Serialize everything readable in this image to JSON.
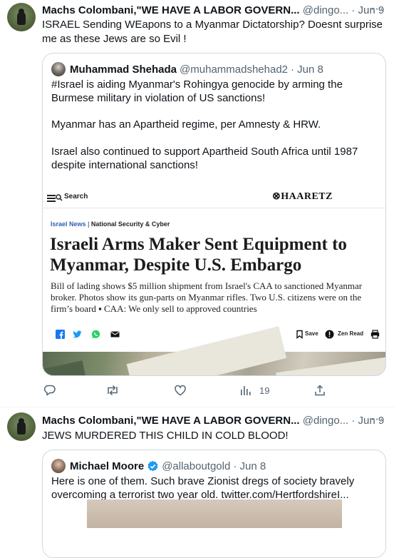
{
  "tweet1": {
    "author_name": "Machs Colombani,\"WE HAVE A LABOR GOVERN...",
    "author_handle": "@dingo...",
    "date": "· Jun 9",
    "more": "···",
    "text": "ISRAEL Sending WEapons to a Myanmar Dictatorship? Doesnt surprise me as these Jews are so Evil !",
    "quote": {
      "author_name": "Muhammad Shehada",
      "author_handle": "@muhammadshehad2",
      "date": "· Jun 8",
      "text_p1": "#Israel is aiding Myanmar's Rohingya genocide by arming the Burmese military in violation of US sanctions!",
      "text_p2": "Myanmar has an Apartheid regime, per Amnesty & HRW.",
      "text_p3": "Israel also continued to support Apartheid South Africa until 1987 despite international sanctions!",
      "article": {
        "search_label": "Search",
        "site_name": "⊗HAARETZ",
        "section": "Israel News",
        "separator": " | ",
        "subsection": "National Security & Cyber",
        "headline": "Israeli Arms Maker Sent Equipment to Myanmar, Despite U.S. Embargo",
        "subhead": "Bill of lading shows $5 million shipment from Israel's CAA to sanctioned Myanmar broker. Photos show its gun-parts on Myanmar rifles. Two U.S. citizens were on the firm’s board ▪ CAA: We only sell to approved countries",
        "save_label": "Save",
        "zen_label": "Zen Read"
      }
    },
    "actions": {
      "views": "19"
    }
  },
  "tweet2": {
    "author_name": "Machs Colombani,\"WE HAVE A LABOR GOVERN...",
    "author_handle": "@dingo...",
    "date": "· Jun 9",
    "more": "···",
    "text": "JEWS MURDERED THIS CHILD IN COLD BLOOD!",
    "quote": {
      "author_name": "Michael Moore",
      "author_handle": "@allaboutgold",
      "date": "· Jun 8",
      "text": "Here is one of them.  Such brave Zionist dregs of society bravely overcoming a terrorist two year old.  twitter.com/HertfordshireI..."
    }
  },
  "colors": {
    "text": "#0f1419",
    "muted": "#536471",
    "border": "#cfd9de",
    "verified": "#1d9bf0",
    "facebook": "#1877f2",
    "twitter": "#1d9bf0",
    "whatsapp": "#25d366"
  }
}
